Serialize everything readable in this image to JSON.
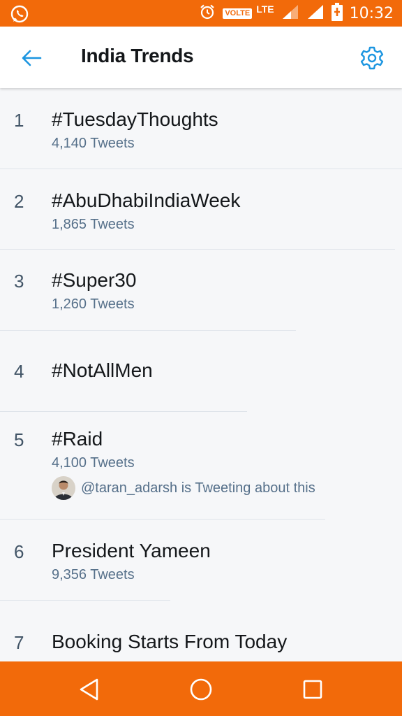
{
  "status_bar": {
    "volte": "VOLTE",
    "network": "LTE",
    "time": "10:32",
    "icons": [
      "whatsapp-icon",
      "alarm-icon",
      "signal-icon",
      "battery-charging-icon"
    ]
  },
  "header": {
    "title": "India Trends",
    "back_icon": "arrow-left-icon",
    "settings_icon": "gear-icon"
  },
  "trends": [
    {
      "rank": "1",
      "name": "#TuesdayThoughts",
      "count": "4,140 Tweets"
    },
    {
      "rank": "2",
      "name": "#AbuDhabiIndiaWeek",
      "count": "1,865 Tweets"
    },
    {
      "rank": "3",
      "name": "#Super30",
      "count": "1,260 Tweets"
    },
    {
      "rank": "4",
      "name": "#NotAllMen"
    },
    {
      "rank": "5",
      "name": "#Raid",
      "count": "4,100 Tweets",
      "context": "@taran_adarsh is Tweeting about this"
    },
    {
      "rank": "6",
      "name": "President Yameen",
      "count": "9,356 Tweets"
    },
    {
      "rank": "7",
      "name": "Booking Starts From Today"
    }
  ],
  "nav_bar": {
    "buttons": [
      "back-triangle-icon",
      "home-circle-icon",
      "recents-square-icon"
    ]
  },
  "colors": {
    "accent": "#f26a0a",
    "twitter_blue": "#1b95e0",
    "text_primary": "#14171a",
    "text_secondary": "#56708a"
  }
}
